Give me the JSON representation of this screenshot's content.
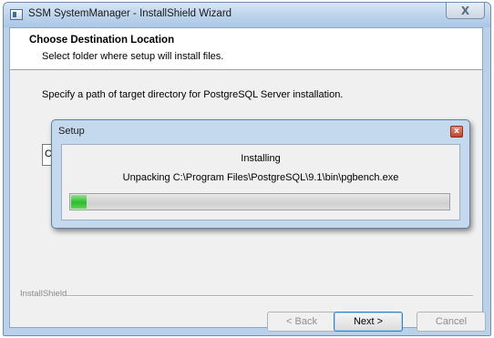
{
  "window": {
    "title": "SSM SystemManager - InstallShield Wizard",
    "close_glyph": "X"
  },
  "header": {
    "title": "Choose Destination Location",
    "subtitle": "Select folder where setup will install files."
  },
  "body": {
    "instruction": "Specify a path of target directory for PostgreSQL Server installation.",
    "destination_field_visible_text": "C"
  },
  "footer": {
    "brand": "InstallShield",
    "back_label": "< Back",
    "next_label": "Next >",
    "cancel_label": "Cancel"
  },
  "progress_dialog": {
    "title": "Setup",
    "close_glyph": "x",
    "status": "Installing",
    "detail": "Unpacking C:\\Program Files\\PostgreSQL\\9.1\\bin\\pgbench.exe",
    "progress": 0.045
  },
  "colors": {
    "progress_fill": "#2cbc2c",
    "accent": "#3c7fb1"
  }
}
